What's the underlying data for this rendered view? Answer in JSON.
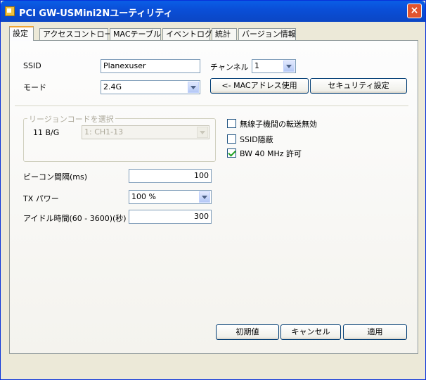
{
  "window": {
    "title": "PCI GW-USMini2Nユーティリティ",
    "close": "×"
  },
  "tabs": [
    {
      "label": "設定",
      "active": true
    },
    {
      "label": "アクセスコントロール"
    },
    {
      "label": "MACテーブル"
    },
    {
      "label": "イベントログ"
    },
    {
      "label": "統計"
    },
    {
      "label": "バージョン情報"
    }
  ],
  "settings": {
    "ssid_label": "SSID",
    "ssid_value": "Planexuser",
    "channel_label": "チャンネル",
    "channel_value": "1",
    "mode_label": "モード",
    "mode_value": "2.4G",
    "mac_button": "<- MACアドレス使用",
    "security_button": "セキュリティ設定",
    "region_group": "リージョンコードを選択",
    "region_band_label": "11 B/G",
    "region_value": "1: CH1-13",
    "cb_isolation": {
      "label": "無線子機間の転送無効",
      "checked": false
    },
    "cb_hide_ssid": {
      "label": "SSID隠蔽",
      "checked": false
    },
    "cb_bw40": {
      "label": "BW 40 MHz 許可",
      "checked": true
    },
    "beacon_label": "ビーコン間隔(ms)",
    "beacon_value": "100",
    "txpower_label": "TX パワー",
    "txpower_value": "100 %",
    "idle_label": "アイドル時間(60 - 3600)(秒)",
    "idle_value": "300"
  },
  "footer": {
    "defaults_button": "初期値",
    "cancel_button": "キャンセル",
    "apply_button": "適用"
  }
}
